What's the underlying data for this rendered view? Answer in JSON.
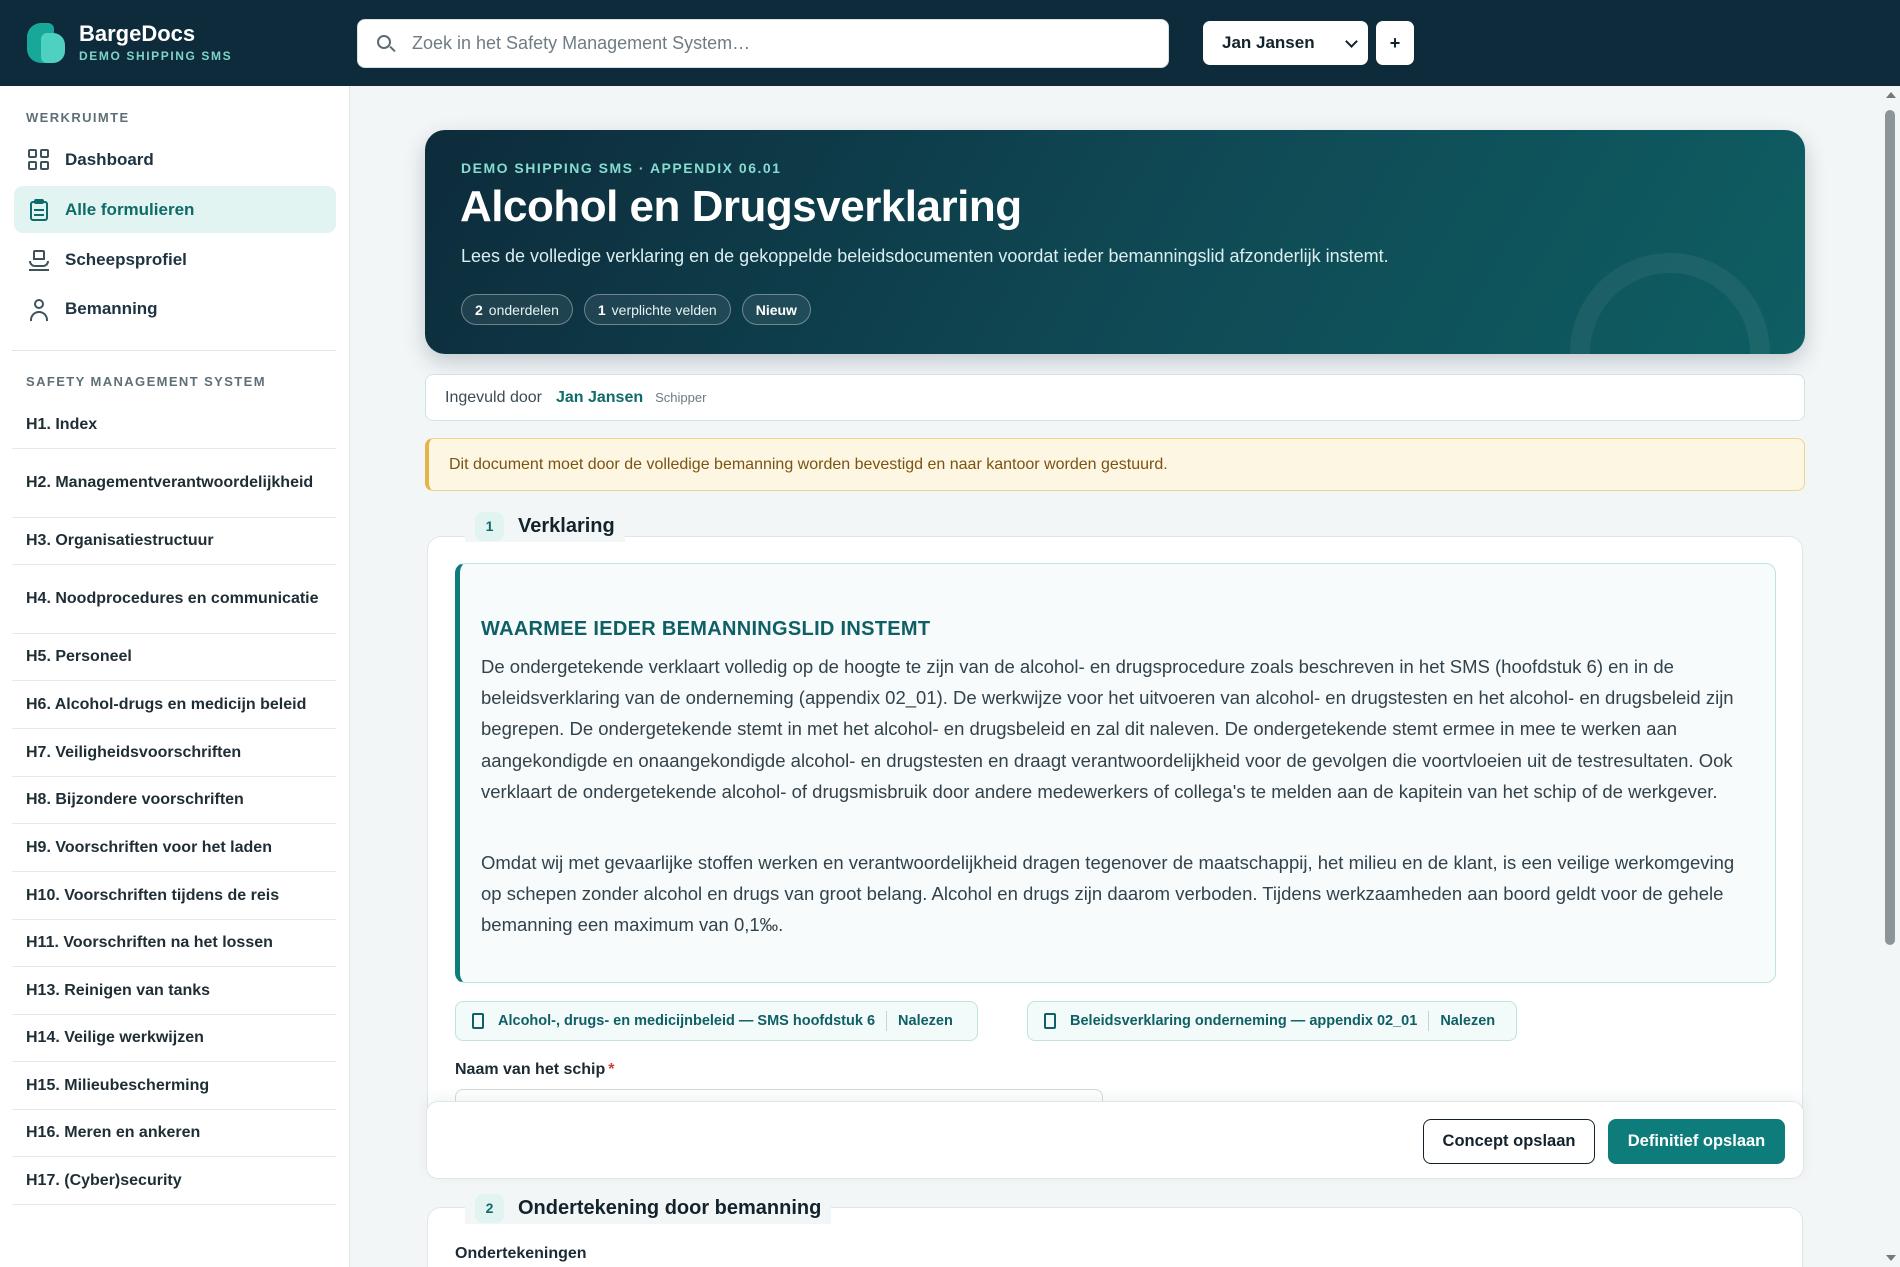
{
  "brand": {
    "name": "BargeDocs",
    "subtitle": "DEMO SHIPPING SMS"
  },
  "search": {
    "placeholder": "Zoek in het Safety Management System…"
  },
  "user": {
    "selected": "Jan Jansen",
    "add_label": "+"
  },
  "sidebar": {
    "workspace_heading": "WERKRUIMTE",
    "workspace_items": [
      {
        "label": "Dashboard",
        "icon": "grid-icon"
      },
      {
        "label": "Alle formulieren",
        "icon": "clipboard-icon",
        "active": true
      },
      {
        "label": "Scheepsprofiel",
        "icon": "ship-icon"
      },
      {
        "label": "Bemanning",
        "icon": "user-icon"
      }
    ],
    "sms_heading": "SAFETY MANAGEMENT SYSTEM",
    "sms_items": [
      "H1. Index",
      "H2. Managementverantwoordelijkheid",
      "H3. Organisatiestructuur",
      "H4. Noodprocedures en communicatie",
      "H5. Personeel",
      "H6. Alcohol-drugs en medicijn beleid",
      "H7. Veiligheidsvoorschriften",
      "H8. Bijzondere voorschriften",
      "H9. Voorschriften voor het laden",
      "H10. Voorschriften tijdens de reis",
      "H11. Voorschriften na het lossen",
      "H13. Reinigen van tanks",
      "H14. Veilige werkwijzen",
      "H15. Milieubescherming",
      "H16. Meren en ankeren",
      "H17. (Cyber)security"
    ]
  },
  "hero": {
    "kicker": "DEMO SHIPPING SMS · APPENDIX 06.01",
    "title": "Alcohol en Drugsverklaring",
    "description": "Lees de volledige verklaring en de gekoppelde beleidsdocumenten voordat ieder bemanningslid afzonderlijk instemt.",
    "chips": [
      {
        "count": "2",
        "label": "onderdelen"
      },
      {
        "count": "1",
        "label": "verplichte velden"
      },
      {
        "count": "",
        "label": "Nieuw"
      }
    ]
  },
  "filled_by": {
    "label": "Ingevuld door",
    "name": "Jan Jansen",
    "role": "Schipper"
  },
  "notice": "Dit document moet door de volledige bemanning worden bevestigd en naar kantoor worden gestuurd.",
  "section1": {
    "number": "1",
    "title": "Verklaring",
    "declaration_heading": "WAARMEE IEDER BEMANNINGSLID INSTEMT",
    "paragraph1": "De ondergetekende verklaart volledig op de hoogte te zijn van de alcohol- en drugsprocedure zoals beschreven in het SMS (hoofdstuk 6) en in de beleidsverklaring van de onderneming (appendix 02_01). De werkwijze voor het uitvoeren van alcohol- en drugstesten en het alcohol- en drugsbeleid zijn begrepen. De ondergetekende stemt in met het alcohol- en drugsbeleid en zal dit naleven. De ondergetekende stemt ermee in mee te werken aan aangekondigde en onaangekondigde alcohol- en drugstesten en draagt verantwoordelijkheid voor de gevolgen die voortvloeien uit de testresultaten. Ook verklaart de ondergetekende alcohol- of drugsmisbruik door andere medewerkers of collega's te melden aan de kapitein van het schip of de werkgever.",
    "paragraph2": "Omdat wij met gevaarlijke stoffen werken en verantwoordelijkheid dragen tegenover de maatschappij, het milieu en de klant, is een veilige werkomgeving op schepen zonder alcohol en drugs van groot belang. Alcohol en drugs zijn daarom verboden. Tijdens werkzaamheden aan boord geldt voor de gehele bemanning een maximum van 0,1‰.",
    "links": [
      {
        "label": "Alcohol-, drugs- en medicijnbeleid — SMS hoofdstuk 6",
        "action": "Nalezen"
      },
      {
        "label": "Beleidsverklaring onderneming — appendix 02_01",
        "action": "Nalezen"
      }
    ],
    "field_label": "Naam van het schip",
    "field_required": "*"
  },
  "actions": {
    "draft": "Concept opslaan",
    "final": "Definitief opslaan"
  },
  "section2": {
    "number": "2",
    "title": "Ondertekening door bemanning",
    "sub_label": "Ondertekeningen"
  },
  "colors": {
    "accent": "#0e7c7b",
    "topbar": "#0d2b3b",
    "notice": "#fdf6e3"
  }
}
